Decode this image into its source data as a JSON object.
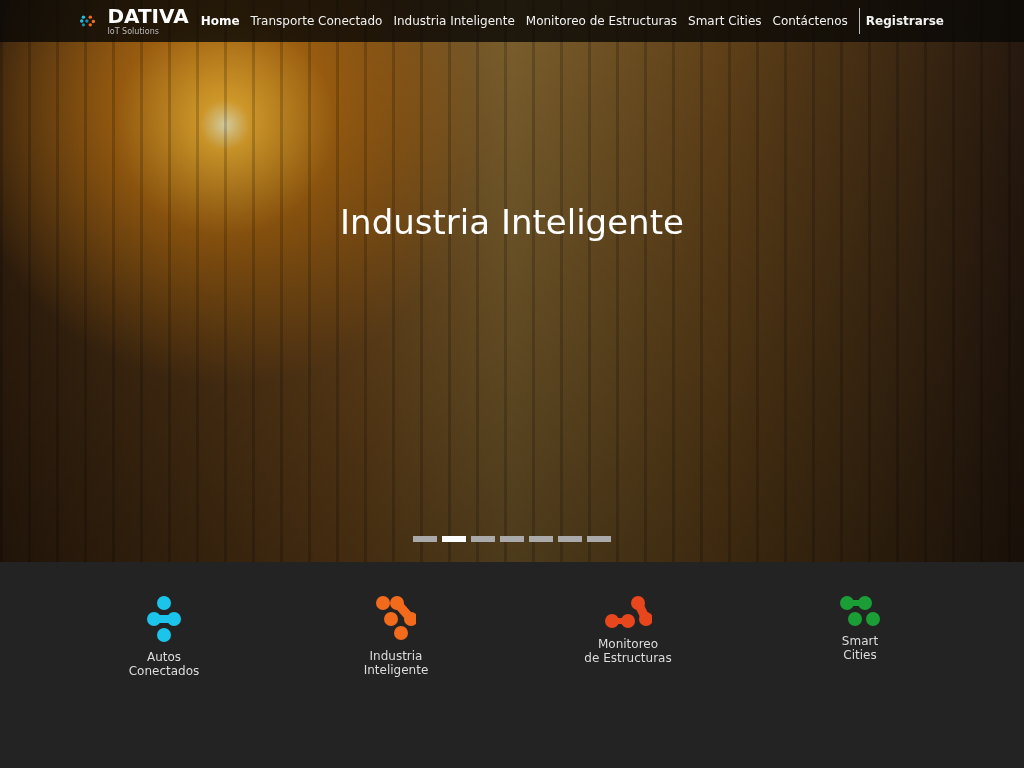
{
  "logo": {
    "name": "DATIVA",
    "tagline": "IoT Solutions"
  },
  "nav": [
    {
      "label": "Home",
      "selected": true,
      "kind": "link"
    },
    {
      "label": "Transporte Conectado",
      "selected": false,
      "kind": "link"
    },
    {
      "label": "Industria Inteligente",
      "selected": false,
      "kind": "link"
    },
    {
      "label": "Monitoreo de Estructuras",
      "selected": false,
      "kind": "link"
    },
    {
      "label": "Smart Cities",
      "selected": false,
      "kind": "link"
    },
    {
      "label": "Contáctenos",
      "selected": false,
      "kind": "link"
    },
    {
      "label": "Registrarse",
      "selected": false,
      "kind": "cta"
    }
  ],
  "hero": {
    "title": "Industria Inteligente",
    "slides": [
      {
        "selected": false
      },
      {
        "selected": true
      },
      {
        "selected": false
      },
      {
        "selected": false
      },
      {
        "selected": false
      },
      {
        "selected": false
      },
      {
        "selected": false
      }
    ]
  },
  "features": [
    {
      "kind": "cross",
      "color": "#1cc4ec",
      "lines": [
        "Autos",
        "Conectados"
      ]
    },
    {
      "kind": "zigzag",
      "color": "#f26b1d",
      "lines": [
        "Industria",
        "Inteligente"
      ]
    },
    {
      "kind": "wave",
      "color": "#e8461c",
      "lines": [
        "Monitoreo",
        "de Estructuras"
      ]
    },
    {
      "kind": "triad",
      "color": "#1a9e35",
      "lines": [
        "Smart",
        "Cities"
      ]
    }
  ]
}
